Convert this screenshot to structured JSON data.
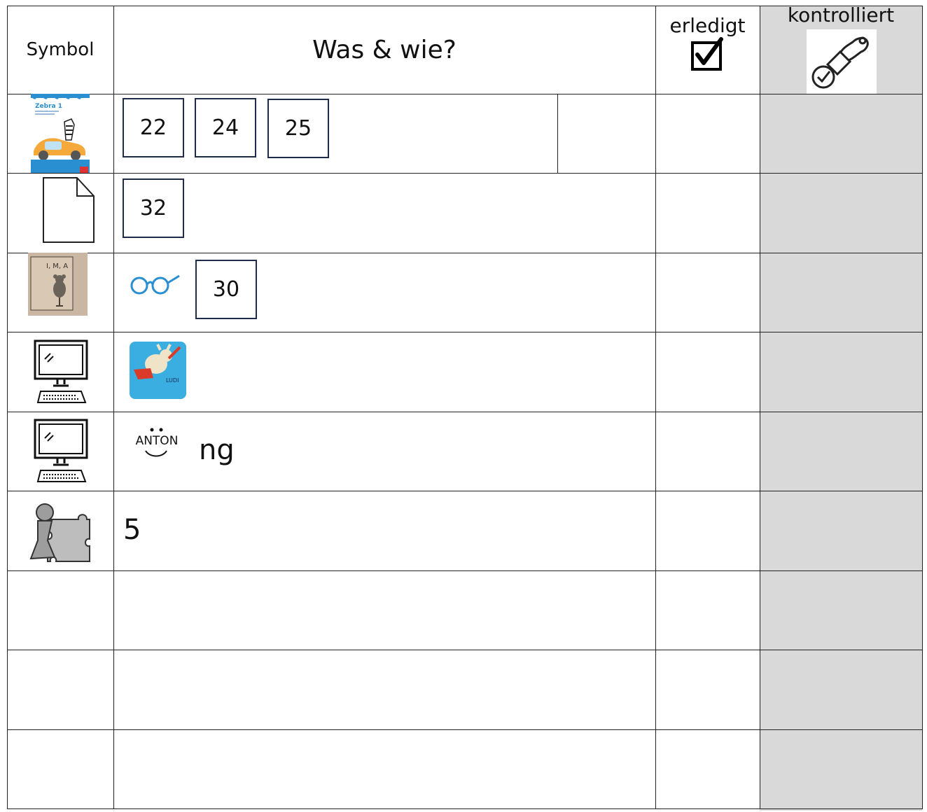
{
  "header": {
    "symbol": "Symbol",
    "was_wie": "Was & wie?",
    "erledigt": "erledigt",
    "erledigt_mark": "☑",
    "kontrolliert": "kontrolliert"
  },
  "rows": [
    {
      "symbol_icon": "zebra-book-cover-icon",
      "pages": [
        "22",
        "24",
        "25"
      ]
    },
    {
      "symbol_icon": "worksheet-page-icon",
      "pages": [
        "32"
      ]
    },
    {
      "symbol_icon": "ima-mouse-card-icon",
      "extra_icon": "glasses-icon",
      "pages": [
        "30"
      ]
    },
    {
      "symbol_icon": "computer-icon",
      "app_icon": "ludi-app-icon"
    },
    {
      "symbol_icon": "computer-icon",
      "app_icon": "anton-app-icon",
      "anton_logo": "ANTON",
      "text": "ng"
    },
    {
      "symbol_icon": "game-puzzle-icon",
      "text": "5"
    },
    {},
    {},
    {}
  ],
  "colors": {
    "kontrolliert_column": "#d9d9d9",
    "box_border": "#1f2b4a",
    "glasses": "#2a8fd0",
    "ludi_bg": "#3aaee0"
  }
}
